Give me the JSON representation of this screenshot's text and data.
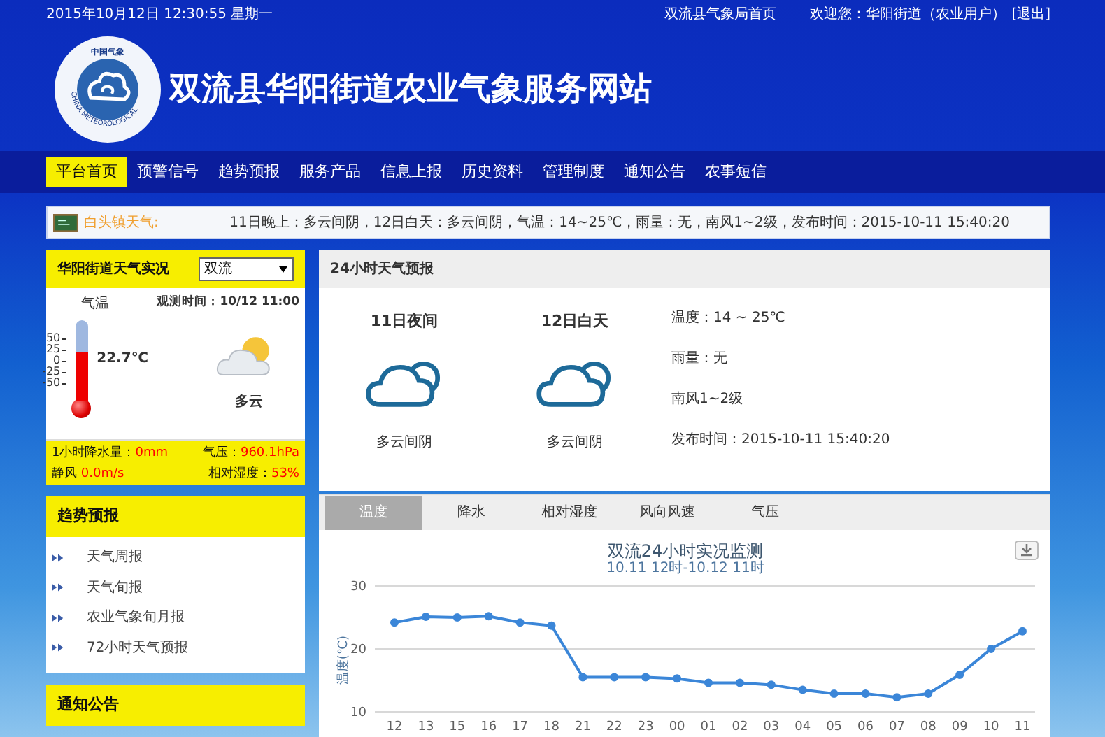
{
  "top_bar": {
    "datetime": "2015年10月12日 12:30:55 星期一",
    "home_link": "双流县气象局首页",
    "welcome": "欢迎您：华阳街道（农业用户）",
    "logout": "[退出]"
  },
  "header": {
    "title": "双流县华阳街道农业气象服务网站",
    "logo_top_text": "中国气象",
    "logo_text": "CHINA METEOROLOGICAL"
  },
  "nav": [
    {
      "label": "平台首页",
      "selected": true
    },
    {
      "label": "预警信号",
      "selected": false
    },
    {
      "label": "趋势预报",
      "selected": false
    },
    {
      "label": "服务产品",
      "selected": false
    },
    {
      "label": "信息上报",
      "selected": false
    },
    {
      "label": "历史资料",
      "selected": false
    },
    {
      "label": "管理制度",
      "selected": false
    },
    {
      "label": "通知公告",
      "selected": false
    },
    {
      "label": "农事短信",
      "selected": false
    }
  ],
  "ticker": {
    "label": "白头镇天气:",
    "text": "11日晚上：多云间阴，12日白天：多云间阴，气温：14~25℃，雨量：无，南风1~2级，发布时间：2015-10-11 15:40:20"
  },
  "live": {
    "title": "华阳街道天气实况",
    "station": "双流",
    "temp_label": "气温",
    "obs_time": "观测时间：10/12 11:00",
    "scale": [
      "50",
      "25",
      "0",
      "-25",
      "-50"
    ],
    "level": 0.6,
    "temperature": "22.7℃",
    "condition": "多云",
    "stats": [
      {
        "label": "1小时降水量：",
        "value": "0mm"
      },
      {
        "label": "气压：",
        "value": "960.1hPa"
      },
      {
        "label": "静风",
        "value": "0.0m/s"
      },
      {
        "label": "相对湿度：",
        "value": "53%"
      }
    ]
  },
  "trend": {
    "title": "趋势预报",
    "items": [
      "天气周报",
      "天气旬报",
      "农业气象旬月报",
      "72小时天气预报"
    ]
  },
  "notice": {
    "title": "通知公告"
  },
  "forecast": {
    "title": "24小时天气预报",
    "periods": [
      {
        "label": "11日夜间",
        "condition": "多云间阴"
      },
      {
        "label": "12日白天",
        "condition": "多云间阴"
      }
    ],
    "details": [
      "温度：14 ~ 25℃",
      "雨量：无",
      "南风1~2级",
      "发布时间：2015-10-11 15:40:20"
    ]
  },
  "chart_tabs": [
    {
      "label": "温度",
      "selected": true
    },
    {
      "label": "降水",
      "selected": false
    },
    {
      "label": "相对湿度",
      "selected": false
    },
    {
      "label": "风向风速",
      "selected": false
    },
    {
      "label": "气压",
      "selected": false
    }
  ],
  "chart": {
    "subtitle": "10.11 12时-10.12 11时",
    "chart_data": {
      "type": "line",
      "title": "双流24小时实况监测",
      "ylabel": "温度(℃)",
      "categories": [
        "12",
        "13",
        "15",
        "16",
        "17",
        "18",
        "21",
        "22",
        "23",
        "00",
        "01",
        "02",
        "03",
        "04",
        "05",
        "06",
        "07",
        "08",
        "09",
        "10",
        "11"
      ],
      "series": [
        {
          "color": "#3b86d8",
          "marker": true,
          "values": [
            24.2,
            25.1,
            25.0,
            25.2,
            24.2,
            23.7,
            15.5,
            15.5,
            15.5,
            15.3,
            14.6,
            14.6,
            14.3,
            13.5,
            12.9,
            12.9,
            12.3,
            12.9,
            15.9,
            20.0,
            22.8
          ]
        }
      ],
      "ylim": [
        10,
        30
      ],
      "yticks": [
        10,
        20,
        30
      ]
    }
  }
}
